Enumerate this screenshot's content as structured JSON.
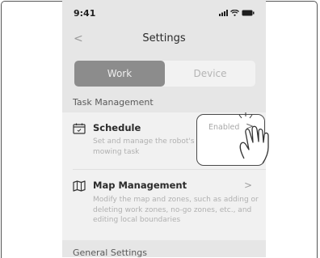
{
  "status_bar": {
    "time": "9:41"
  },
  "header": {
    "back_label": "<",
    "title": "Settings"
  },
  "tabs": [
    {
      "label": "Work",
      "selected": true
    },
    {
      "label": "Device",
      "selected": false
    }
  ],
  "sections": {
    "task_management": "Task Management",
    "general_settings": "General Settings"
  },
  "items": [
    {
      "title": "Schedule",
      "description": "Set and manage the robot's automatic mowing task",
      "value": "Enabled"
    },
    {
      "title": "Map Management",
      "description": "Modify the map and zones, such as adding or deleting work zones, no-go zones, etc., and editing local boundaries"
    }
  ],
  "chevron": ">",
  "colors": {
    "selected_tab": "#8c8c8c",
    "screen_bg": "#e6e6e6",
    "card_bg": "#f1f1f1"
  }
}
